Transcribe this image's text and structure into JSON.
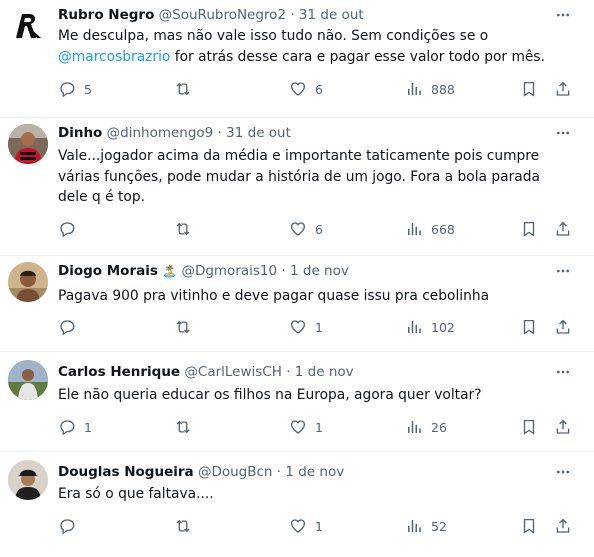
{
  "tweets": [
    {
      "name": "Rubro Negro",
      "handle": "@SouRubroNegro2",
      "separator": "·",
      "date": "31 de out",
      "text_before": "Me desculpa, mas não vale isso tudo não. Sem condições se o ",
      "mention": "@marcosbrazrio",
      "text_after": " for atrás desse cara e pagar esse valor todo por mês.",
      "replies": "5",
      "retweets": "",
      "likes": "6",
      "views": "888",
      "avatar": "flamengo-crest"
    },
    {
      "name": "Dinho",
      "handle": "@dinhomengo9",
      "separator": "·",
      "date": "31 de out",
      "text": "Vale...jogador acima da média e importante taticamente pois cumpre várias funções, pode mudar a história de um jogo. Fora a bola parada dele q é top.",
      "replies": "",
      "retweets": "",
      "likes": "6",
      "views": "668",
      "avatar": "person-red-jersey"
    },
    {
      "name": "Diogo Morais",
      "badge": "🏝️",
      "handle": "@Dgmorais10",
      "separator": "·",
      "date": "1 de nov",
      "text": "Pagava 900 pra vitinho e deve pagar quase issu pra cebolinha",
      "replies": "",
      "retweets": "",
      "likes": "1",
      "views": "102",
      "avatar": "person-beach"
    },
    {
      "name": "Carlos Henrique",
      "handle": "@CarlLewisCH",
      "separator": "·",
      "date": "1 de nov",
      "text": "Ele não queria educar os filhos na Europa, agora quer voltar?",
      "replies": "1",
      "retweets": "",
      "likes": "1",
      "views": "26",
      "avatar": "person-outdoors"
    },
    {
      "name": "Douglas Nogueira",
      "handle": "@DougBcn",
      "separator": "·",
      "date": "1 de nov",
      "text": "Era só o que faltava....",
      "replies": "",
      "retweets": "",
      "likes": "1",
      "views": "52",
      "avatar": "person-cap"
    }
  ],
  "icons": {
    "reply": "reply-icon",
    "retweet": "retweet-icon",
    "like": "heart-icon",
    "views": "views-icon",
    "bookmark": "bookmark-icon",
    "share": "share-icon",
    "more": "more-dots-icon"
  },
  "colors": {
    "text": "#0f1419",
    "secondary": "#536471",
    "link": "#1d9bf0",
    "divider": "#eff3f4",
    "flamengo_red": "#c8102e"
  }
}
